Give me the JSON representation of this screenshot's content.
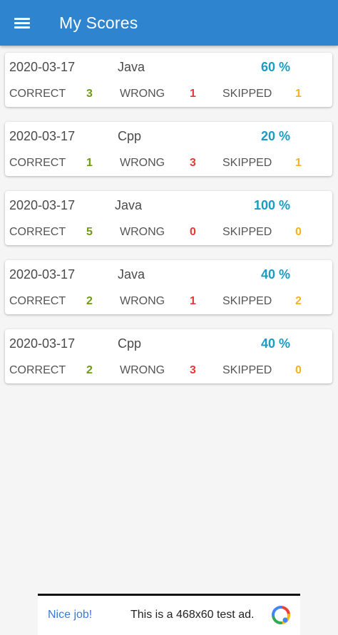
{
  "app_bar": {
    "title": "My Scores",
    "menu_icon": "hamburger-menu-icon",
    "color": "#2f84cf"
  },
  "scores": [
    {
      "date": "2020-03-17",
      "language": "Java",
      "percent": "60 %",
      "correct_label": "CORRECT",
      "correct": "3",
      "wrong_label": "WRONG",
      "wrong": "1",
      "skipped_label": "SKIPPED",
      "skipped": "1"
    },
    {
      "date": "2020-03-17",
      "language": "Cpp",
      "percent": "20 %",
      "correct_label": "CORRECT",
      "correct": "1",
      "wrong_label": "WRONG",
      "wrong": "3",
      "skipped_label": "SKIPPED",
      "skipped": "1"
    },
    {
      "date": "2020-03-17",
      "language": "Java",
      "percent": "100 %",
      "correct_label": "CORRECT",
      "correct": "5",
      "wrong_label": "WRONG",
      "wrong": "0",
      "skipped_label": "SKIPPED",
      "skipped": "0"
    },
    {
      "date": "2020-03-17",
      "language": "Java",
      "percent": "40 %",
      "correct_label": "CORRECT",
      "correct": "2",
      "wrong_label": "WRONG",
      "wrong": "1",
      "skipped_label": "SKIPPED",
      "skipped": "2"
    },
    {
      "date": "2020-03-17",
      "language": "Cpp",
      "percent": "40 %",
      "correct_label": "CORRECT",
      "correct": "2",
      "wrong_label": "WRONG",
      "wrong": "3",
      "skipped_label": "SKIPPED",
      "skipped": "0"
    }
  ],
  "colors": {
    "percent": "#1a9bc4",
    "correct": "#6d9b12",
    "wrong": "#e53935",
    "skipped": "#f2b31c"
  },
  "ad": {
    "left_text": "Nice job!",
    "text": "This is a 468x60 test ad.",
    "logo_icon": "adsense-logo-icon"
  }
}
